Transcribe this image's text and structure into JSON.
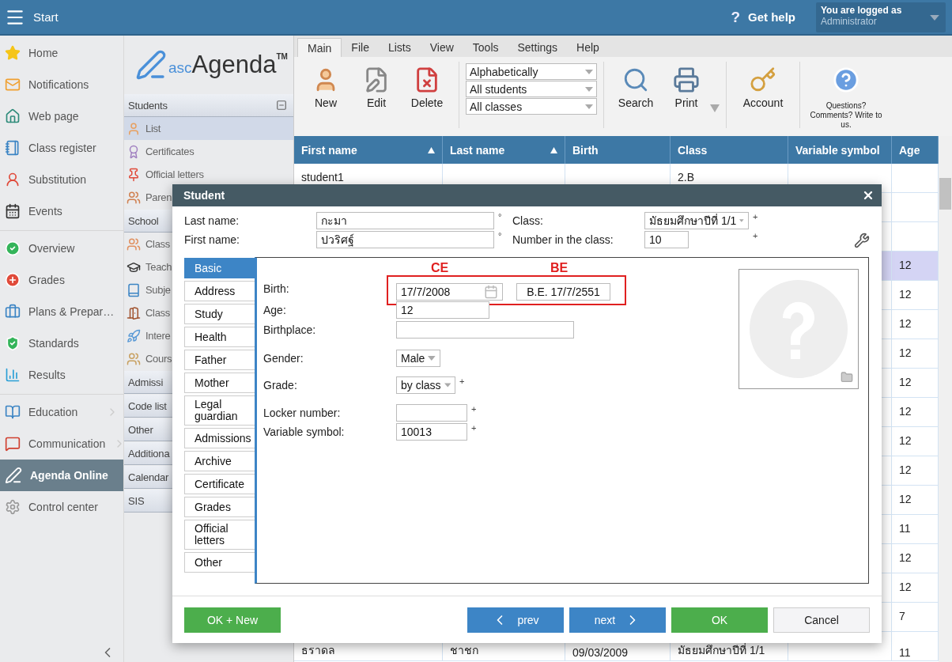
{
  "top_bar": {
    "title": "Start",
    "help_mark": "?",
    "help": "Get help",
    "user": {
      "caption": "You are logged as",
      "name": "Administrator"
    }
  },
  "sidebar": {
    "groups": [
      [
        {
          "label": "Home",
          "selected": false,
          "submenu": false
        },
        {
          "label": "Notifications",
          "selected": false,
          "submenu": false
        },
        {
          "label": "Web page",
          "selected": false,
          "submenu": false
        },
        {
          "label": "Class register",
          "selected": false,
          "submenu": false
        },
        {
          "label": "Substitution",
          "selected": false,
          "submenu": false
        },
        {
          "label": "Events",
          "selected": false,
          "submenu": false
        }
      ],
      [
        {
          "label": "Overview",
          "selected": false,
          "submenu": false
        },
        {
          "label": "Grades",
          "selected": false,
          "submenu": false
        },
        {
          "label": "Plans & Prepar…",
          "selected": false,
          "submenu": false
        },
        {
          "label": "Standards",
          "selected": false,
          "submenu": false
        },
        {
          "label": "Results",
          "selected": false,
          "submenu": false
        }
      ],
      [
        {
          "label": "Education",
          "selected": false,
          "submenu": true
        },
        {
          "label": "Communication",
          "selected": false,
          "submenu": true
        },
        {
          "label": "Agenda Online",
          "selected": true,
          "submenu": false
        },
        {
          "label": "Control center",
          "selected": false,
          "submenu": false
        }
      ]
    ]
  },
  "sections_panel": {
    "logo": {
      "prefix": "asc",
      "name": "Agenda",
      "mark": "TM"
    },
    "groups": [
      {
        "title": "Students",
        "expanded": true,
        "collapse_button": true,
        "items": [
          {
            "label": "List",
            "selected": true
          },
          {
            "label": "Certificates",
            "selected": false
          },
          {
            "label": "Official letters",
            "selected": false
          },
          {
            "label": "Paren",
            "selected": false
          }
        ]
      },
      {
        "title": "School",
        "expanded": true,
        "items": [
          {
            "label": "Class",
            "selected": false
          },
          {
            "label": "Teach",
            "selected": false
          },
          {
            "label": "Subje",
            "selected": false
          },
          {
            "label": "Class",
            "selected": false
          },
          {
            "label": "Intere",
            "selected": false
          },
          {
            "label": "Cours",
            "selected": false
          }
        ]
      },
      {
        "title": "Admissi",
        "expanded": false
      },
      {
        "title": "Code list",
        "expanded": false
      },
      {
        "title": "Other",
        "expanded": false
      },
      {
        "title": "Additiona",
        "expanded": false
      },
      {
        "title": "Calendar",
        "expanded": false
      },
      {
        "title": "SIS",
        "expanded": false
      }
    ]
  },
  "menu_tabs": [
    {
      "label": "Main",
      "selected": true
    },
    {
      "label": "File",
      "selected": false
    },
    {
      "label": "Lists",
      "selected": false
    },
    {
      "label": "View",
      "selected": false
    },
    {
      "label": "Tools",
      "selected": false
    },
    {
      "label": "Settings",
      "selected": false
    },
    {
      "label": "Help",
      "selected": false
    }
  ],
  "toolbar": {
    "actions": [
      {
        "label": "New"
      },
      {
        "label": "Edit"
      },
      {
        "label": "Delete"
      }
    ],
    "filters": [
      "Alphabetically",
      "All students",
      "All classes"
    ],
    "tools": [
      {
        "label": "Search",
        "dropdown": false
      },
      {
        "label": "Print",
        "dropdown": true
      }
    ],
    "account": {
      "label": "Account"
    },
    "feedback": "Questions? Comments? Write to us."
  },
  "table": {
    "columns": [
      {
        "label": "First name",
        "sorted": true
      },
      {
        "label": "Last name",
        "sorted": true
      },
      {
        "label": "Birth",
        "sorted": false
      },
      {
        "label": "Class",
        "sorted": false
      },
      {
        "label": "Variable symbol",
        "sorted": false
      },
      {
        "label": "Age",
        "sorted": false
      }
    ],
    "rows": [
      {
        "first_name": "student1",
        "class": "2.B",
        "selected": false
      },
      {
        "selected": false
      },
      {
        "selected": false
      },
      {
        "age": "12",
        "selected": true
      },
      {
        "age": "12",
        "selected": false
      },
      {
        "age": "12",
        "selected": false
      },
      {
        "age": "12",
        "selected": false
      },
      {
        "age": "12",
        "selected": false
      },
      {
        "age": "12",
        "selected": false
      },
      {
        "age": "12",
        "selected": false
      },
      {
        "age": "12",
        "selected": false
      },
      {
        "age": "12",
        "selected": false
      },
      {
        "age": "11",
        "selected": false
      },
      {
        "age": "12",
        "selected": false
      },
      {
        "age": "12",
        "selected": false
      },
      {
        "age": "7",
        "selected": false
      },
      {
        "first_name": "ธราดล",
        "last_name": "ชาชก",
        "birth": "09/03/2009",
        "class": "มัธยมศึกษาปีที่ 1/1",
        "age": "11",
        "selected": false
      }
    ]
  },
  "dialog": {
    "title": "Student",
    "header_fields": [
      {
        "kind": "text",
        "label": "Last name:",
        "value": "กะมา",
        "marker": "°"
      },
      {
        "kind": "select",
        "label": "Class:",
        "value": "มัธยมศึกษาปีที่ 1/1",
        "marker": "+"
      },
      {
        "kind": "text",
        "label": "First name:",
        "value": "ปวริศฐ์",
        "marker": "°"
      },
      {
        "kind": "text",
        "label": "Number in the class:",
        "value": "10",
        "marker": "+"
      }
    ],
    "tabs": [
      {
        "label": "Basic",
        "selected": true
      },
      {
        "label": "Address",
        "selected": false
      },
      {
        "label": "Study",
        "selected": false
      },
      {
        "label": "Health",
        "selected": false
      },
      {
        "label": "Father",
        "selected": false
      },
      {
        "label": "Mother",
        "selected": false
      },
      {
        "label": "Legal guardian",
        "selected": false
      },
      {
        "label": "Admissions",
        "selected": false
      },
      {
        "label": "Archive",
        "selected": false
      },
      {
        "label": "Certificate",
        "selected": false
      },
      {
        "label": "Grades",
        "selected": false
      },
      {
        "label": "Official letters",
        "selected": false
      },
      {
        "label": "Other",
        "selected": false
      }
    ],
    "annotation": {
      "ce_label": "CE",
      "be_label": "BE"
    },
    "fields": [
      {
        "kind": "date",
        "label": "Birth:",
        "value": "17/7/2008",
        "be_value": "B.E. 17/7/2551"
      },
      {
        "kind": "text",
        "label": "Age:",
        "value": "12"
      },
      {
        "kind": "text",
        "label": "Birthplace:"
      },
      {
        "kind": "select",
        "label": "Gender:",
        "value": "Male"
      },
      {
        "kind": "select",
        "label": "Grade:",
        "value": "by class",
        "marker": "+"
      },
      {
        "kind": "text",
        "label": "Locker number:",
        "marker": "+"
      },
      {
        "kind": "text",
        "label": "Variable symbol:",
        "value": "10013",
        "marker": "+"
      }
    ],
    "buttons": [
      {
        "label": "OK + New",
        "kind": "success"
      },
      {
        "label": "prev",
        "kind": "prev"
      },
      {
        "label": "next",
        "kind": "next"
      },
      {
        "label": "OK",
        "kind": "success"
      },
      {
        "label": "Cancel",
        "kind": "plain"
      }
    ]
  }
}
